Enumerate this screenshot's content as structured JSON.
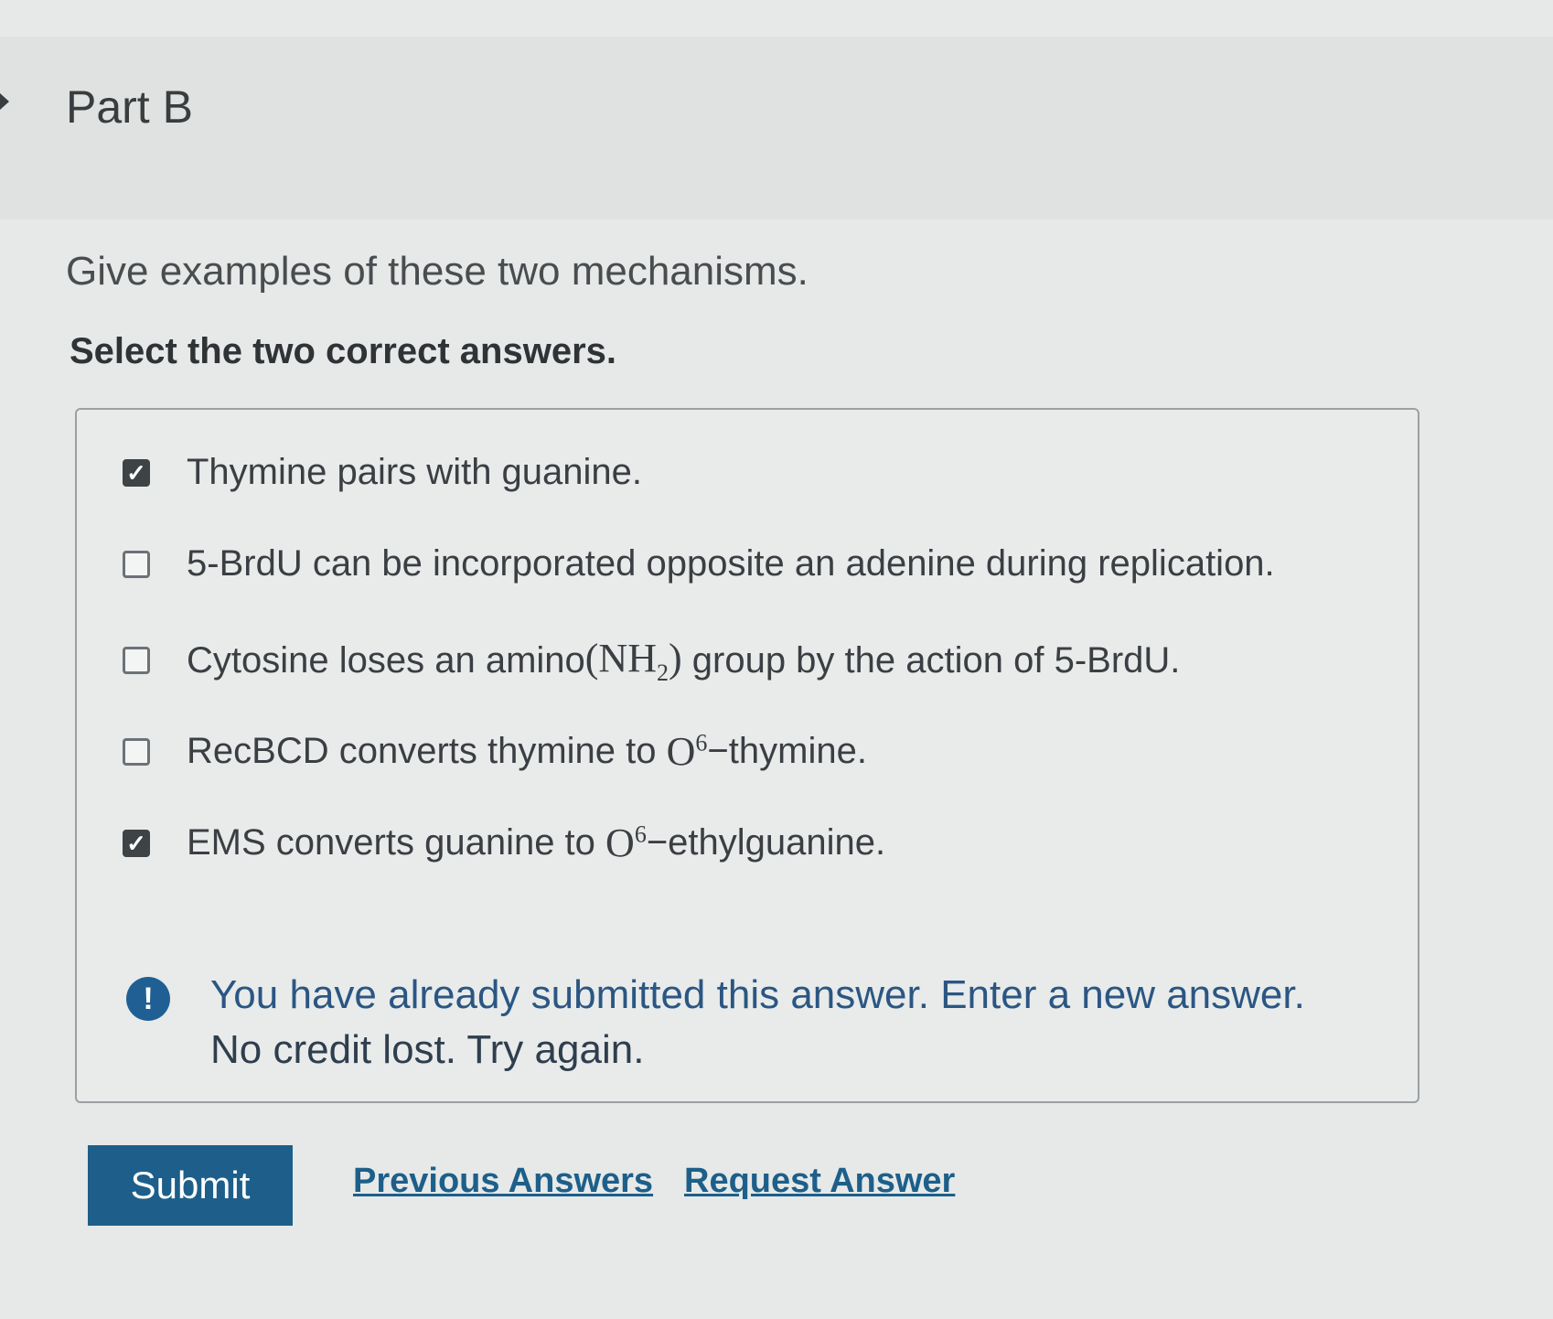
{
  "part": {
    "title": "Part B"
  },
  "question": {
    "prompt": "Give examples of these two mechanisms.",
    "instruction": "Select the two correct answers."
  },
  "options": [
    {
      "pre": "Thymine pairs with guanine.",
      "checked": true
    },
    {
      "pre": "5-BrdU can be incorporated opposite an adenine during replication.",
      "checked": false
    },
    {
      "pre": "Cytosine loses an amino ",
      "math": "(NH",
      "sub": "2",
      "mathEnd": ")",
      "post": " group by the action of 5-BrdU.",
      "checked": false
    },
    {
      "pre": "RecBCD converts thymine to ",
      "math": "O",
      "sup": "6",
      "post": "−thymine.",
      "checked": false
    },
    {
      "pre": "EMS converts guanine to ",
      "math": "O",
      "sup": "6",
      "post": "−ethylguanine.",
      "checked": true
    }
  ],
  "feedback": {
    "icon": "!",
    "line1": "You have already submitted this answer. Enter a new answer.",
    "line2": "No credit lost. Try again."
  },
  "actions": {
    "submit_label": "Submit",
    "previous_label": "Previous Answers",
    "request_label": "Request Answer"
  },
  "colors": {
    "accent": "#1d5f8a",
    "checked_box": "#3e4346"
  },
  "icons": {
    "collapse": "caret-right-icon",
    "checkmark": "checkmark-icon",
    "alert": "exclamation-circle-icon"
  }
}
